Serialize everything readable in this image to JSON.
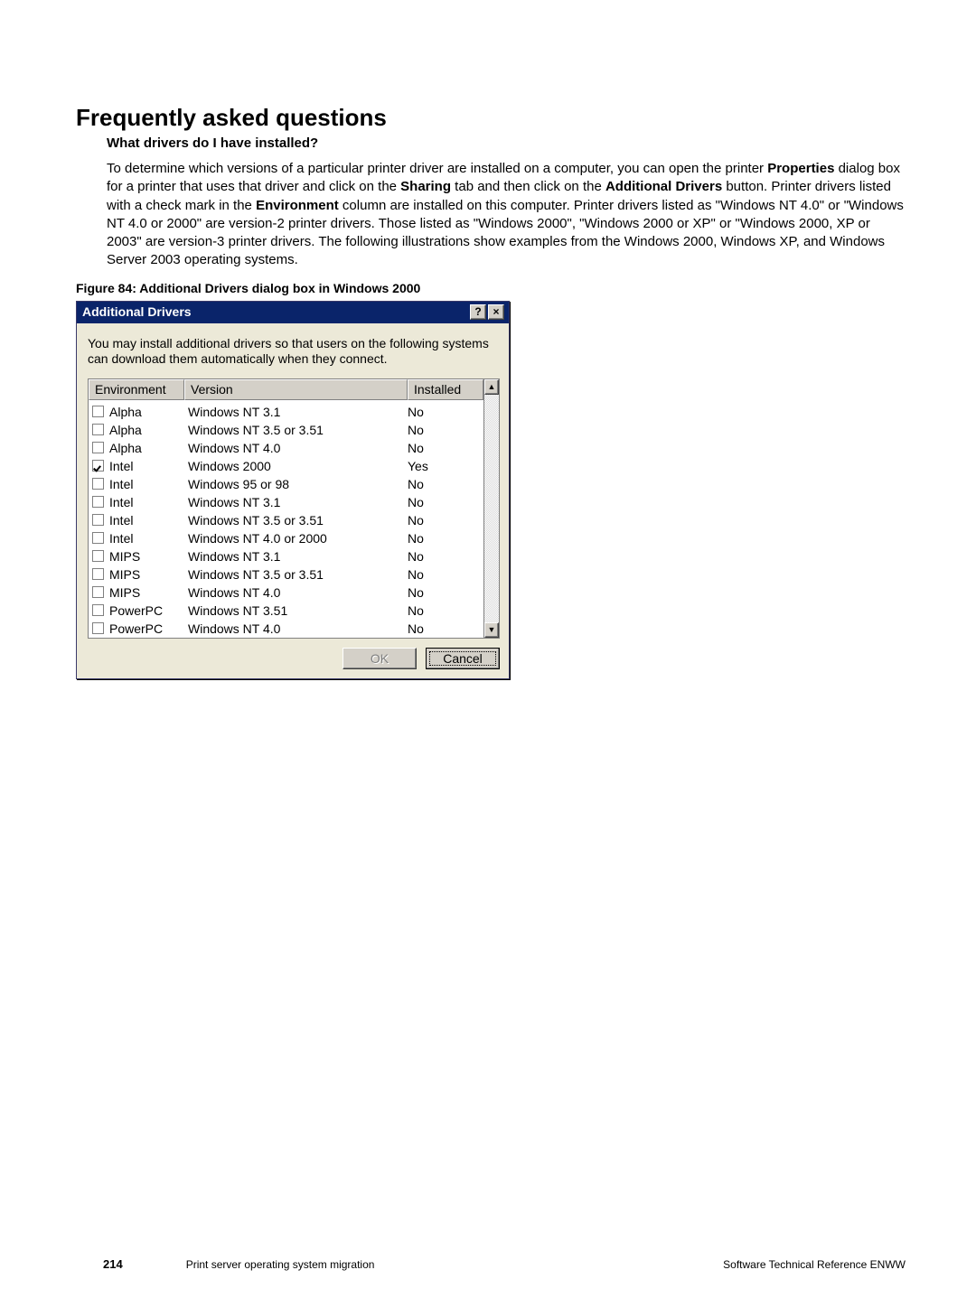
{
  "heading": "Frequently asked questions",
  "question": "What drivers do I have installed?",
  "paragraph_parts": [
    "To determine which versions of a particular printer driver are installed on a computer, you can open the printer ",
    "Properties",
    " dialog box for a printer that uses that driver and click on the ",
    "Sharing",
    " tab and then click on the ",
    "Additional Drivers",
    " button. Printer drivers listed with a check mark in the ",
    "Environment",
    " column are installed on this computer. Printer drivers listed as \"Windows NT 4.0\" or \"Windows NT 4.0 or 2000\" are version-2 printer drivers. Those listed as \"Windows 2000\", \"Windows 2000 or XP\" or \"Windows 2000, XP or 2003\" are version-3 printer drivers. The following illustrations show examples from the Windows 2000, Windows XP, and Windows Server 2003 operating systems."
  ],
  "figure_caption": "Figure 84: Additional Drivers dialog box in Windows 2000",
  "dialog": {
    "title": "Additional Drivers",
    "description": "You may install additional drivers so that users on the following systems can download them automatically when they connect.",
    "columns": {
      "env": "Environment",
      "ver": "Version",
      "inst": "Installed"
    },
    "rows": [
      {
        "checked": false,
        "env": "Alpha",
        "ver": "Windows NT 3.1",
        "inst": "No"
      },
      {
        "checked": false,
        "env": "Alpha",
        "ver": "Windows NT 3.5 or 3.51",
        "inst": "No"
      },
      {
        "checked": false,
        "env": "Alpha",
        "ver": "Windows NT 4.0",
        "inst": "No"
      },
      {
        "checked": true,
        "env": "Intel",
        "ver": "Windows 2000",
        "inst": "Yes"
      },
      {
        "checked": false,
        "env": "Intel",
        "ver": "Windows 95 or 98",
        "inst": "No"
      },
      {
        "checked": false,
        "env": "Intel",
        "ver": "Windows NT 3.1",
        "inst": "No"
      },
      {
        "checked": false,
        "env": "Intel",
        "ver": "Windows NT 3.5 or 3.51",
        "inst": "No"
      },
      {
        "checked": false,
        "env": "Intel",
        "ver": "Windows NT 4.0 or 2000",
        "inst": "No"
      },
      {
        "checked": false,
        "env": "MIPS",
        "ver": "Windows NT 3.1",
        "inst": "No"
      },
      {
        "checked": false,
        "env": "MIPS",
        "ver": "Windows NT 3.5 or 3.51",
        "inst": "No"
      },
      {
        "checked": false,
        "env": "MIPS",
        "ver": "Windows NT 4.0",
        "inst": "No"
      },
      {
        "checked": false,
        "env": "PowerPC",
        "ver": "Windows NT 3.51",
        "inst": "No"
      },
      {
        "checked": false,
        "env": "PowerPC",
        "ver": "Windows NT 4.0",
        "inst": "No"
      }
    ],
    "buttons": {
      "ok": "OK",
      "cancel": "Cancel"
    }
  },
  "footer": {
    "page": "214",
    "center": "Print server operating system migration",
    "right": "Software Technical Reference ENWW"
  }
}
